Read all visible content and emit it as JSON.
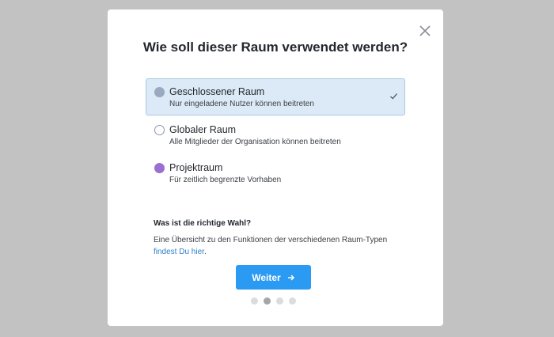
{
  "dialog": {
    "title": "Wie soll dieser Raum verwendet werden?",
    "options": [
      {
        "label": "Geschlossener Raum",
        "description": "Nur eingeladene Nutzer können beitreten",
        "color": "#9aa8c0",
        "selected": true
      },
      {
        "label": "Globaler Raum",
        "description": "Alle Mitglieder der Organisation können beitreten",
        "color": "#ffffff",
        "selected": false
      },
      {
        "label": "Projektraum",
        "description": "Für zeitlich begrenzte Vorhaben",
        "color": "#9b6fcf",
        "selected": false
      }
    ],
    "help": {
      "title": "Was ist die richtige Wahl?",
      "text": "Eine Übersicht zu den Funktionen der verschiedenen Raum-Typen",
      "link": "findest Du hier",
      "suffix": "."
    },
    "next_button": "Weiter",
    "pagination": {
      "total": 4,
      "current": 2
    }
  },
  "colors": {
    "overlay": "#c2c2c2",
    "accent": "#2b9af3",
    "link": "#2f7fc9",
    "selected_bg": "#dbeaf6"
  }
}
